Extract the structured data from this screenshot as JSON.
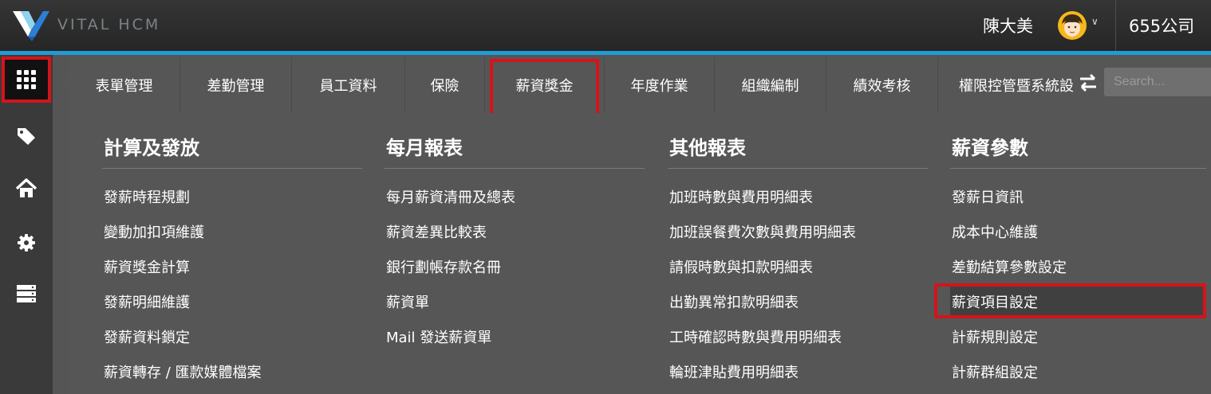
{
  "header": {
    "brand": "VITAL HCM",
    "user_name": "陳大美",
    "company": "655公司"
  },
  "sidebar": {
    "items": [
      "apps-icon",
      "tag-icon",
      "home-icon",
      "gear-icon",
      "server-icon"
    ]
  },
  "tabs": [
    {
      "label": "表單管理"
    },
    {
      "label": "差勤管理"
    },
    {
      "label": "員工資料"
    },
    {
      "label": "保險"
    },
    {
      "label": "薪資獎金",
      "active": true
    },
    {
      "label": "年度作業"
    },
    {
      "label": "組織編制"
    },
    {
      "label": "績效考核"
    },
    {
      "label": "權限控管暨系統設"
    }
  ],
  "search": {
    "placeholder": "Search..."
  },
  "columns": [
    {
      "title": "計算及發放",
      "items": [
        "發薪時程規劃",
        "變動加扣項維護",
        "薪資獎金計算",
        "發薪明細維護",
        "發薪資料鎖定",
        "薪資轉存 / 匯款媒體檔案"
      ]
    },
    {
      "title": "每月報表",
      "items": [
        "每月薪資清冊及總表",
        "薪資差異比較表",
        "銀行劃帳存款名冊",
        "薪資單",
        "Mail 發送薪資單"
      ]
    },
    {
      "title": "其他報表",
      "items": [
        "加班時數與費用明細表",
        "加班誤餐費次數與費用明細表",
        "請假時數與扣款明細表",
        "出勤異常扣款明細表",
        "工時確認時數與費用明細表",
        "輪班津貼費用明細表"
      ]
    },
    {
      "title": "薪資參數",
      "items": [
        "發薪日資訊",
        "成本中心維護",
        "差勤結算參數設定",
        "薪資項目設定",
        "計薪規則設定",
        "計薪群組設定"
      ],
      "selected_index": 3
    }
  ],
  "colors": {
    "accent": "#1f9bd6",
    "highlight": "#d4141a",
    "topbar": "#2b2b2b",
    "panel": "#565656"
  }
}
